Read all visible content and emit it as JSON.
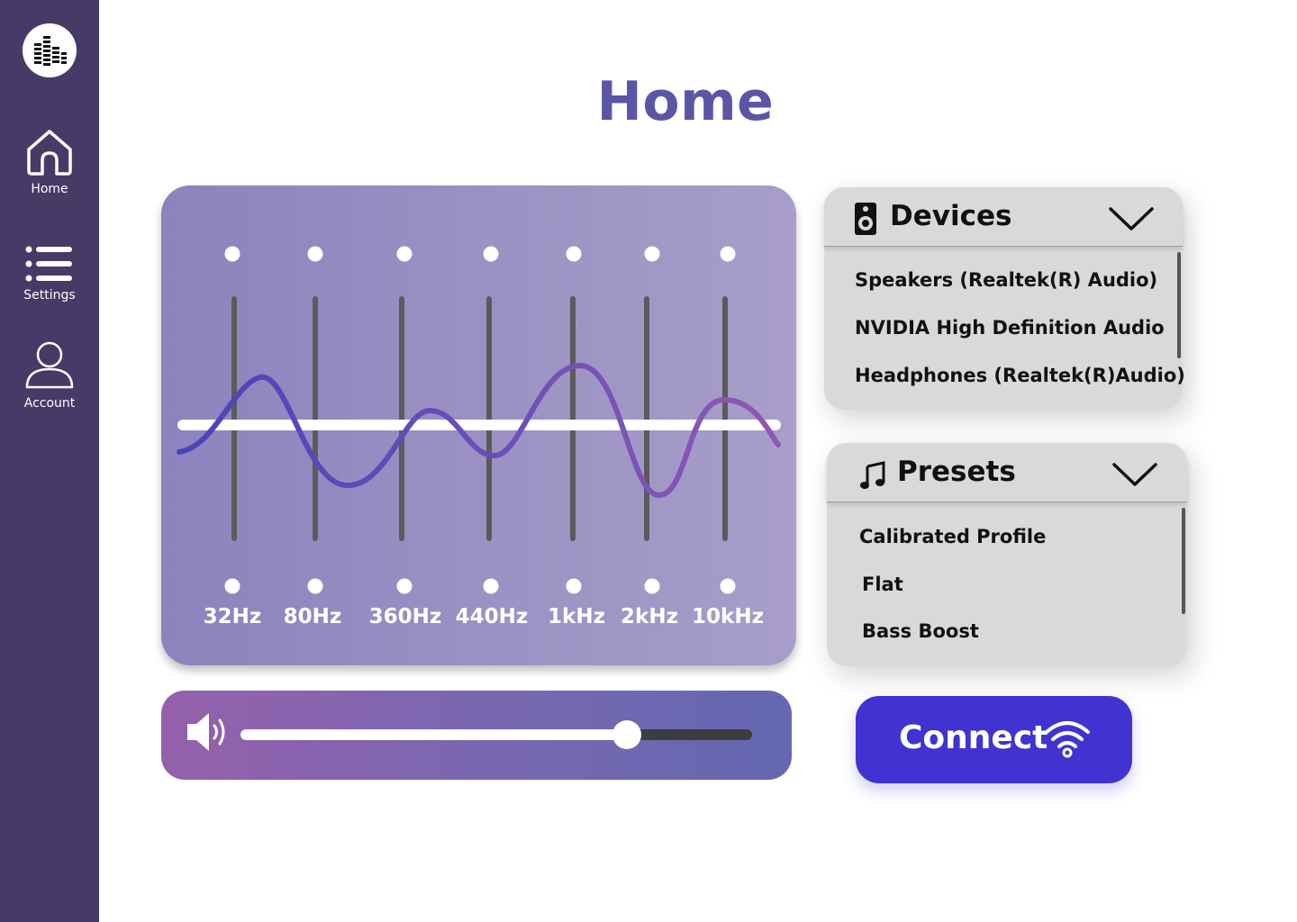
{
  "sidebar": {
    "logo_icon": "equalizer-bars-icon",
    "items": [
      {
        "label": "Home",
        "icon": "home-icon"
      },
      {
        "label": "Settings",
        "icon": "list-icon"
      },
      {
        "label": "Account",
        "icon": "user-icon"
      }
    ]
  },
  "page": {
    "title": "Home"
  },
  "equalizer": {
    "bands": [
      "32Hz",
      "80Hz",
      "360Hz",
      "440Hz",
      "1kHz",
      "2kHz",
      "10kHz"
    ]
  },
  "volume": {
    "icon": "speaker-icon",
    "level_fraction": 0.755
  },
  "devices": {
    "title": "Devices",
    "icon": "speaker-device-icon",
    "items": [
      "Speakers (Realtek(R) Audio)",
      "NVIDIA High Definition Audio",
      "Headphones (Realtek(R)Audio)"
    ]
  },
  "presets": {
    "title": "Presets",
    "icon": "music-note-icon",
    "items": [
      "Calibrated Profile",
      "Flat",
      "Bass Boost"
    ]
  },
  "connect": {
    "label": "Connect",
    "icon": "wifi-icon"
  },
  "colors": {
    "sidebar": "#473a66",
    "title": "#5b55a6",
    "connect_button": "#4033d1"
  }
}
